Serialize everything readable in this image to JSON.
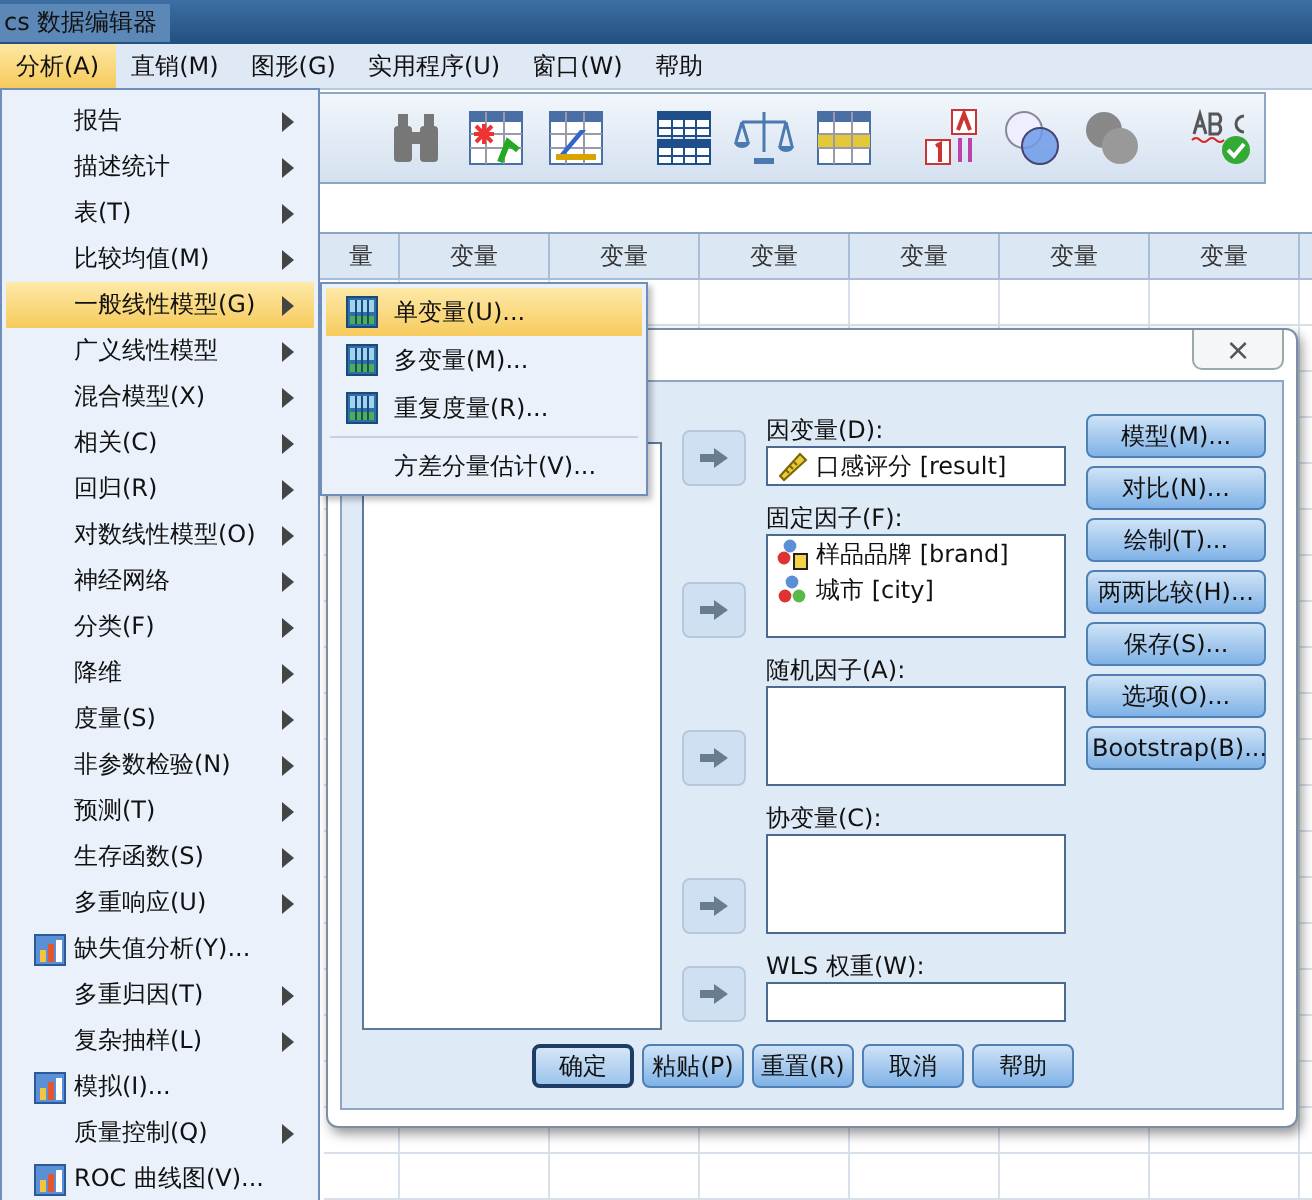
{
  "window": {
    "title": "cs 数据编辑器"
  },
  "menu_bar": [
    {
      "label": "分析(A)",
      "selected": true
    },
    {
      "label": "直销(M)",
      "selected": false
    },
    {
      "label": "图形(G)",
      "selected": false
    },
    {
      "label": "实用程序(U)",
      "selected": false
    },
    {
      "label": "窗口(W)",
      "selected": false
    },
    {
      "label": "帮助",
      "selected": false
    }
  ],
  "grid": {
    "columns": [
      "量",
      "变量",
      "变量",
      "变量",
      "变量",
      "变量",
      "变量"
    ]
  },
  "analyze_menu": [
    {
      "label": "报告",
      "kind": "submenu",
      "icon": false,
      "selected": false
    },
    {
      "label": "描述统计",
      "kind": "submenu",
      "icon": false,
      "selected": false
    },
    {
      "label": "表(T)",
      "kind": "submenu",
      "icon": false,
      "selected": false
    },
    {
      "label": "比较均值(M)",
      "kind": "submenu",
      "icon": false,
      "selected": false
    },
    {
      "label": "一般线性模型(G)",
      "kind": "submenu",
      "icon": false,
      "selected": true
    },
    {
      "label": "广义线性模型",
      "kind": "submenu",
      "icon": false,
      "selected": false
    },
    {
      "label": "混合模型(X)",
      "kind": "submenu",
      "icon": false,
      "selected": false
    },
    {
      "label": "相关(C)",
      "kind": "submenu",
      "icon": false,
      "selected": false
    },
    {
      "label": "回归(R)",
      "kind": "submenu",
      "icon": false,
      "selected": false
    },
    {
      "label": "对数线性模型(O)",
      "kind": "submenu",
      "icon": false,
      "selected": false
    },
    {
      "label": "神经网络",
      "kind": "submenu",
      "icon": false,
      "selected": false
    },
    {
      "label": "分类(F)",
      "kind": "submenu",
      "icon": false,
      "selected": false
    },
    {
      "label": "降维",
      "kind": "submenu",
      "icon": false,
      "selected": false
    },
    {
      "label": "度量(S)",
      "kind": "submenu",
      "icon": false,
      "selected": false
    },
    {
      "label": "非参数检验(N)",
      "kind": "submenu",
      "icon": false,
      "selected": false
    },
    {
      "label": "预测(T)",
      "kind": "submenu",
      "icon": false,
      "selected": false
    },
    {
      "label": "生存函数(S)",
      "kind": "submenu",
      "icon": false,
      "selected": false
    },
    {
      "label": "多重响应(U)",
      "kind": "submenu",
      "icon": false,
      "selected": false
    },
    {
      "label": "缺失值分析(Y)...",
      "kind": "dialog",
      "icon": true,
      "selected": false
    },
    {
      "label": "多重归因(T)",
      "kind": "submenu",
      "icon": false,
      "selected": false
    },
    {
      "label": "复杂抽样(L)",
      "kind": "submenu",
      "icon": false,
      "selected": false
    },
    {
      "label": "模拟(I)...",
      "kind": "dialog",
      "icon": true,
      "selected": false
    },
    {
      "label": "质量控制(Q)",
      "kind": "submenu",
      "icon": false,
      "selected": false
    },
    {
      "label": "ROC 曲线图(V)...",
      "kind": "dialog",
      "icon": true,
      "selected": false
    }
  ],
  "glm_submenu": [
    {
      "label": "单变量(U)...",
      "kind": "glm",
      "selected": true
    },
    {
      "label": "多变量(M)...",
      "kind": "glm",
      "selected": false
    },
    {
      "label": "重复度量(R)...",
      "kind": "glm",
      "selected": false
    },
    {
      "label": "方差分量估计(V)...",
      "kind": "plain",
      "selected": false
    }
  ],
  "dialog": {
    "close": "×",
    "targets": [
      {
        "label": "因变量(D):",
        "kind": "single",
        "items": [
          {
            "name": "口感评分 [result]",
            "kind": "scale"
          }
        ]
      },
      {
        "label": "固定因子(F):",
        "kind": "list",
        "items": [
          {
            "name": "样品品牌 [brand]",
            "kind": "nominal-string"
          },
          {
            "name": "城市 [city]",
            "kind": "nominal"
          }
        ]
      },
      {
        "label": "随机因子(A):",
        "kind": "list"
      },
      {
        "label": "协变量(C):",
        "kind": "list"
      },
      {
        "label": "WLS 权重(W):",
        "kind": "single"
      }
    ],
    "side_buttons": [
      "模型(M)...",
      "对比(N)...",
      "绘制(T)...",
      "两两比较(H)...",
      "保存(S)...",
      "选项(O)...",
      "Bootstrap(B)..."
    ],
    "bottom_buttons": [
      {
        "label": "确定",
        "default": true
      },
      {
        "label": "粘贴(P)",
        "default": false
      },
      {
        "label": "重置(R)",
        "default": false
      },
      {
        "label": "取消",
        "default": false
      },
      {
        "label": "帮助",
        "default": false
      }
    ]
  }
}
